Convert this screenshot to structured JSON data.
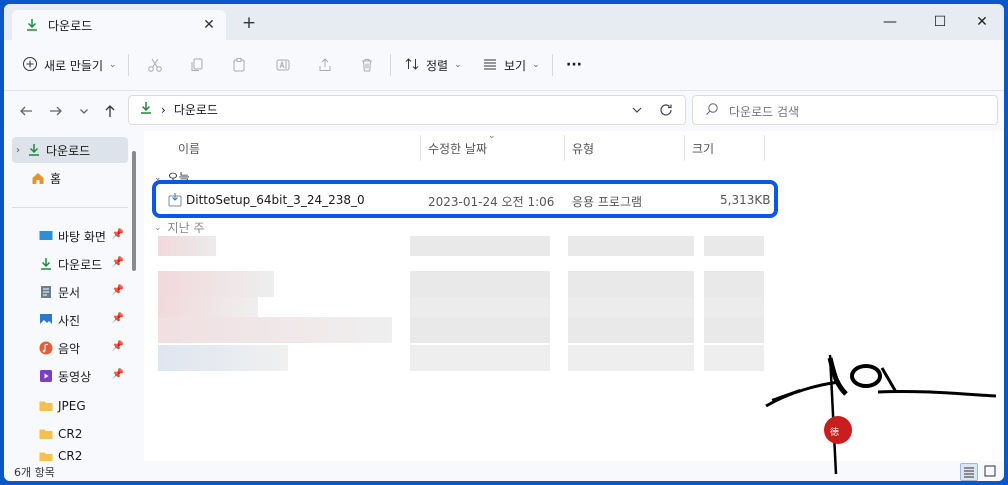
{
  "tab": {
    "title": "다운로드",
    "close": "✕",
    "new_tab": "+"
  },
  "window_controls": {
    "minimize": "—",
    "maximize": "☐",
    "close": "✕"
  },
  "toolbar": {
    "new_label": "새로 만들기",
    "sort_label": "정렬",
    "view_label": "보기",
    "more_label": "···"
  },
  "address": {
    "breadcrumb_sep": "›",
    "location": "다운로드"
  },
  "search": {
    "placeholder": "다운로드 검색"
  },
  "sidebar": {
    "items": [
      {
        "label": "다운로드",
        "icon": "download-icon",
        "pinned": false
      },
      {
        "label": "홈",
        "icon": "home-icon",
        "pinned": false
      },
      {
        "label": "바탕 화면",
        "icon": "desktop-icon",
        "pinned": true
      },
      {
        "label": "다운로드",
        "icon": "download-icon",
        "pinned": true
      },
      {
        "label": "문서",
        "icon": "document-icon",
        "pinned": true
      },
      {
        "label": "사진",
        "icon": "pictures-icon",
        "pinned": true
      },
      {
        "label": "음악",
        "icon": "music-icon",
        "pinned": true
      },
      {
        "label": "동영상",
        "icon": "video-icon",
        "pinned": true
      },
      {
        "label": "JPEG",
        "icon": "folder-icon",
        "pinned": false
      },
      {
        "label": "CR2",
        "icon": "folder-icon",
        "pinned": false
      },
      {
        "label": "CR2",
        "icon": "folder-icon",
        "pinned": false
      }
    ]
  },
  "columns": {
    "name": "이름",
    "modified": "수정한 날짜",
    "type": "유형",
    "size": "크기"
  },
  "groups": {
    "today": "오늘",
    "earlier": "지난 주"
  },
  "file": {
    "name": "DittoSetup_64bit_3_24_238_0",
    "modified": "2023-01-24 오전 1:06",
    "type": "응용 프로그램",
    "size": "5,313KB"
  },
  "status": {
    "item_count": "6개 항목"
  },
  "colors": {
    "accent": "#0a57ea",
    "download_green": "#1f8b3a",
    "folder_yellow": "#f2c14e"
  }
}
